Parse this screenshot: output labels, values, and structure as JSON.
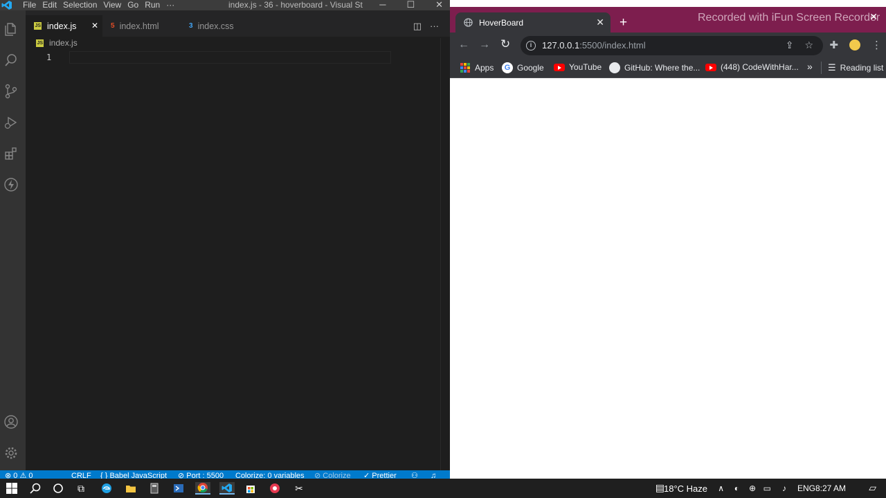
{
  "vscode": {
    "menu": [
      "File",
      "Edit",
      "Selection",
      "View",
      "Go",
      "Run",
      "···"
    ],
    "window_title": "index.js - 36 - hoverboard - Visual St...",
    "tabs": [
      {
        "label": "index.js",
        "icon": "js-file-icon",
        "active": true,
        "close": "✕"
      },
      {
        "label": "index.html",
        "icon": "html-file-icon",
        "active": false
      },
      {
        "label": "index.css",
        "icon": "css-file-icon",
        "active": false
      }
    ],
    "breadcrumb": "index.js",
    "line_number": "1",
    "status": {
      "problems": "⊗ 0 ⚠ 0",
      "eol": "CRLF",
      "language": "{ } Babel JavaScript",
      "port": "⊘ Port : 5500",
      "colorize": "Colorize: 0 variables",
      "colorize_btn": "⊘ Colorize",
      "prettier": "✓ Prettier"
    }
  },
  "chrome": {
    "tab_title": "HoverBoard",
    "tab_close": "✕",
    "new_tab": "+",
    "recorder_text": "Recorded with iFun Screen Recorder",
    "url_host": "127.0.0.1",
    "url_rest": ":5500/index.html",
    "bookmarks": [
      {
        "label": "Apps",
        "icon": "apps-grid-icon"
      },
      {
        "label": "Google",
        "icon": "google-icon"
      },
      {
        "label": "YouTube",
        "icon": "youtube-icon"
      },
      {
        "label": "GitHub: Where the...",
        "icon": "github-icon"
      },
      {
        "label": "(448) CodeWithHar...",
        "icon": "youtube-icon"
      }
    ],
    "more_bookmarks": "»",
    "reading_list": "Reading list"
  },
  "taskbar": {
    "weather": "18°C  Haze",
    "language": "ENG",
    "time": "8:27 AM"
  },
  "colors": {
    "vscode_bg": "#1e1e1e",
    "status_bar": "#007acc",
    "chrome_tabstrip": "#7d1e4e",
    "chrome_toolbar": "#35363a"
  }
}
